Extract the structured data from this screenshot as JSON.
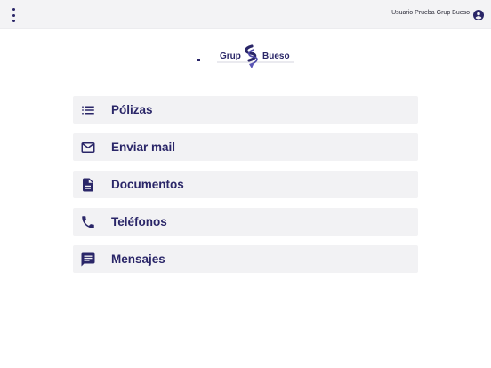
{
  "header": {
    "menu_icon": "more-vert-icon",
    "user_name": "Usuario Prueba Grup Bueso",
    "user_icon": "account-circle-icon"
  },
  "logo": {
    "text_left": "Grup",
    "text_right": "Bueso"
  },
  "menu": {
    "items": [
      {
        "label": "Pólizas",
        "icon": "list-icon"
      },
      {
        "label": "Enviar mail",
        "icon": "mail-icon"
      },
      {
        "label": "Documentos",
        "icon": "document-icon"
      },
      {
        "label": "Teléfonos",
        "icon": "phone-icon"
      },
      {
        "label": "Mensajes",
        "icon": "message-icon"
      }
    ]
  },
  "colors": {
    "accent": "#2a2668",
    "topbar": "#f3f3f5",
    "card": "#f2f2f4"
  }
}
